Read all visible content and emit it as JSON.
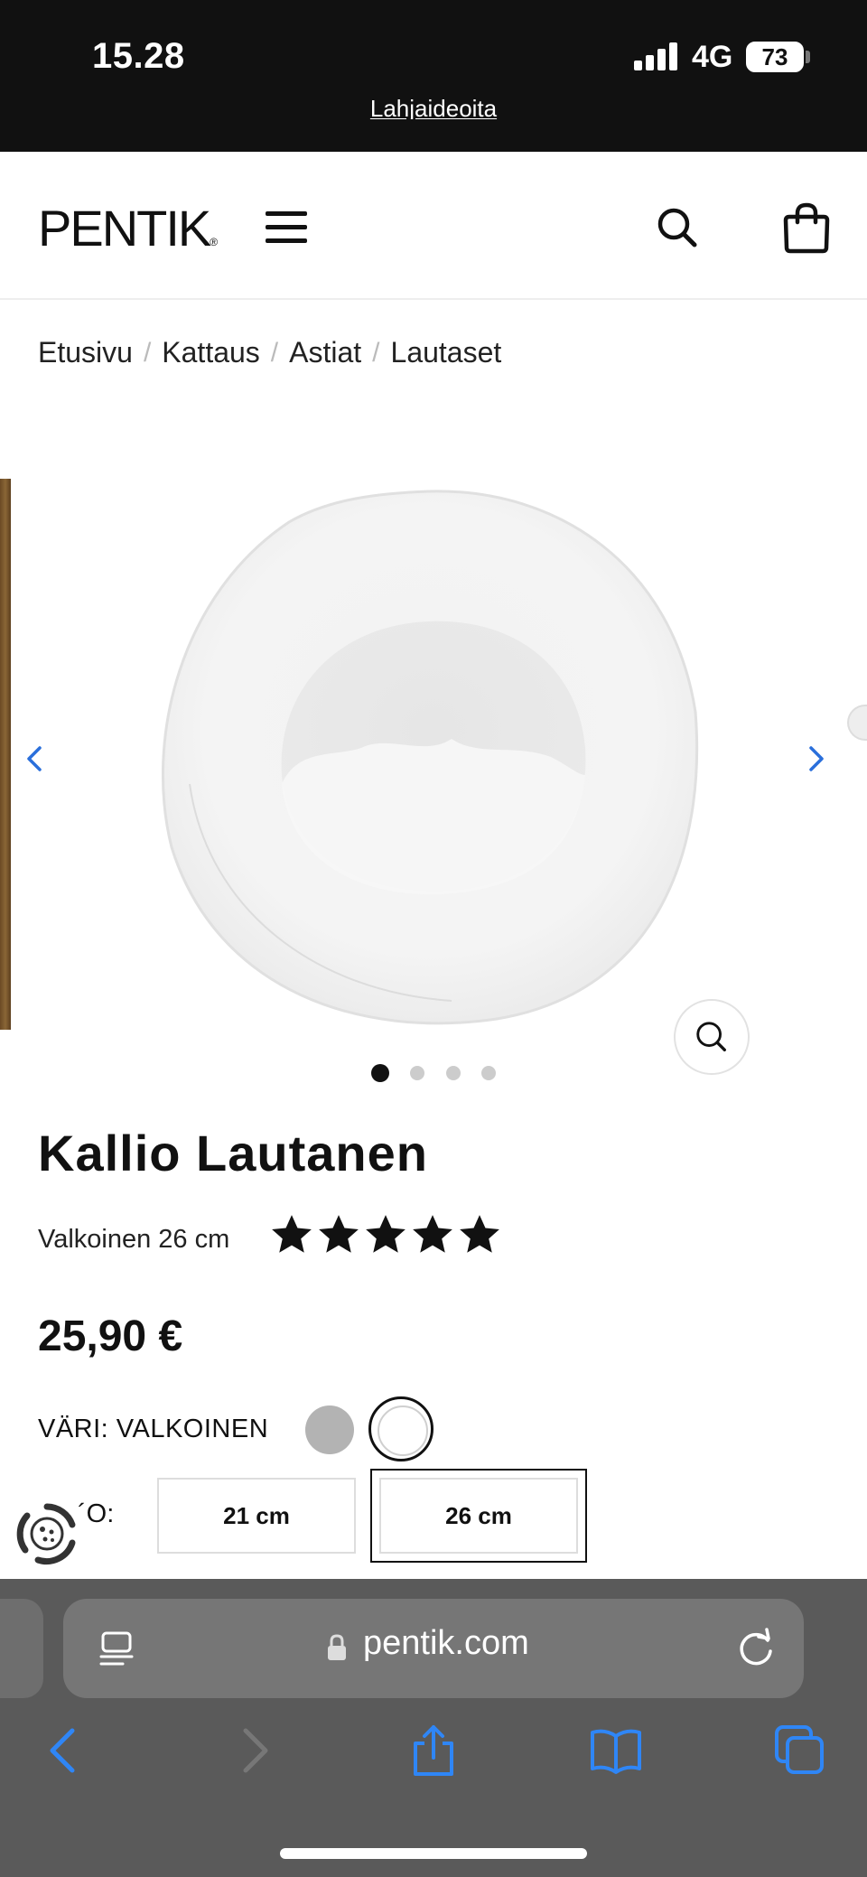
{
  "status_bar": {
    "time": "15.28",
    "network": "4G",
    "battery": "73"
  },
  "promo_banner": {
    "text": "Lahjaideoita"
  },
  "header": {
    "logo": "PENTIK",
    "icons": [
      "menu-icon",
      "search-icon",
      "shopping-bag-icon"
    ]
  },
  "breadcrumb": {
    "items": [
      "Etusivu",
      "Kattaus",
      "Astiat",
      "Lautaset"
    ],
    "separator": "/"
  },
  "gallery": {
    "image_count": 4,
    "active_index": 0,
    "icons": [
      "chevron-left-icon",
      "chevron-right-icon",
      "zoom-icon"
    ],
    "arrow_color": "#2a6fdb"
  },
  "product": {
    "title": "Kallio Lautanen",
    "subtitle": "Valkoinen 26 cm",
    "rating": 5,
    "rating_max": 5,
    "price": "25,90 €",
    "color_label": "VÄRI: VALKOINEN",
    "colors": [
      {
        "name": "grey",
        "hex": "#b3b3b3",
        "selected": false
      },
      {
        "name": "white",
        "hex": "#ffffff",
        "selected": true
      }
    ],
    "size_label_fragment": "´O:",
    "sizes": [
      {
        "label": "21 cm",
        "selected": false
      },
      {
        "label": "26 cm",
        "selected": true
      }
    ]
  },
  "safari": {
    "url": "pentik.com",
    "accent": "#2f86f6",
    "toolbar_icons": [
      "back-icon",
      "forward-icon",
      "share-icon",
      "bookmarks-icon",
      "tabs-icon"
    ]
  }
}
